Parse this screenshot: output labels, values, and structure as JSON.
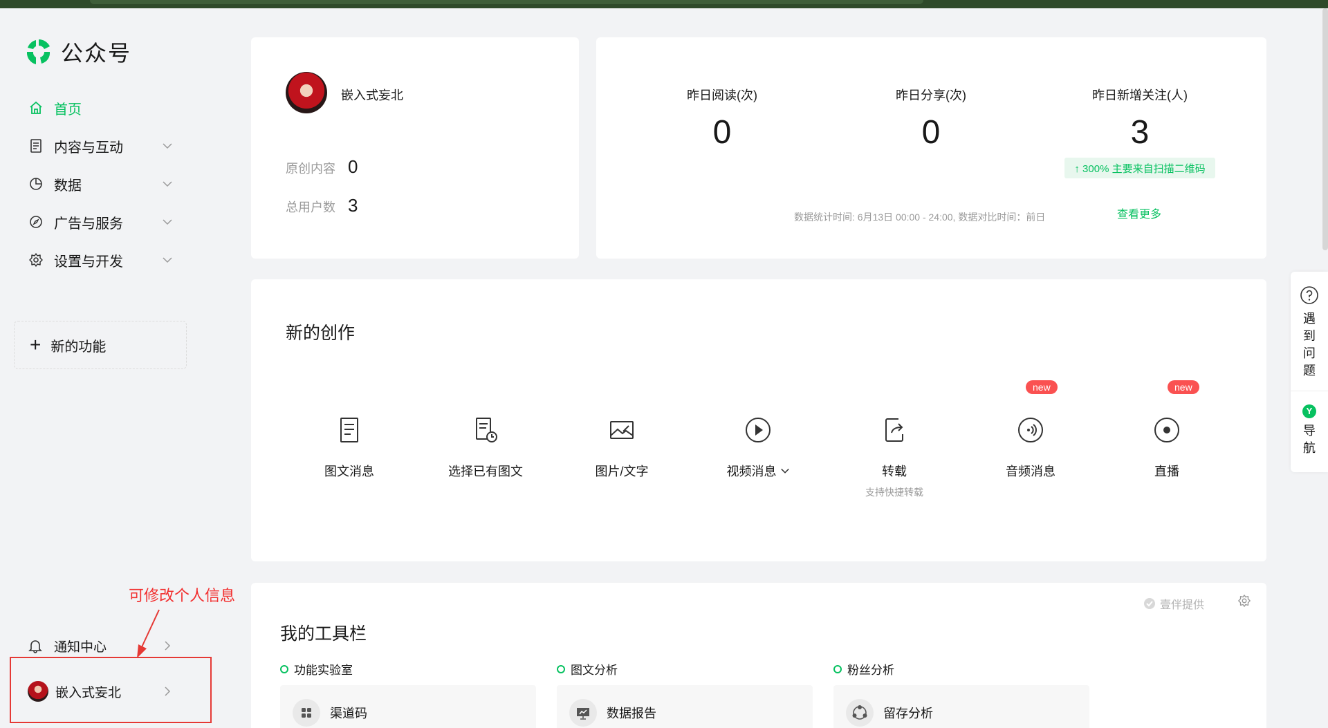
{
  "app": {
    "logo_text": "公众号",
    "brand_color": "#07c160"
  },
  "sidebar": {
    "items": [
      {
        "label": "首页",
        "icon": "home-icon",
        "active": true
      },
      {
        "label": "内容与互动",
        "icon": "document-icon"
      },
      {
        "label": "数据",
        "icon": "chart-pie-icon"
      },
      {
        "label": "广告与服务",
        "icon": "compass-icon"
      },
      {
        "label": "设置与开发",
        "icon": "gear-icon"
      }
    ],
    "new_feature": "新的功能",
    "annotation": "可修改个人信息",
    "notification": "通知中心",
    "account": "嵌入式妄北"
  },
  "profile": {
    "name": "嵌入式妄北",
    "original_label": "原创内容",
    "original_value": "0",
    "users_label": "总用户数",
    "users_value": "3"
  },
  "stats": {
    "items": [
      {
        "label": "昨日阅读(次)",
        "value": "0"
      },
      {
        "label": "昨日分享(次)",
        "value": "0"
      },
      {
        "label": "昨日新增关注(人)",
        "value": "3"
      }
    ],
    "growth": "↑ 300%   主要来自扫描二维码",
    "note": "数据统计时间: 6月13日 00:00 - 24:00, 数据对比时间：前日",
    "more": "查看更多"
  },
  "create": {
    "title": "新的创作",
    "badge": "new",
    "tools": [
      {
        "label": "图文消息",
        "icon": "article-icon"
      },
      {
        "label": "选择已有图文",
        "icon": "select-article-icon"
      },
      {
        "label": "图片/文字",
        "icon": "image-text-icon"
      },
      {
        "label": "视频消息",
        "icon": "video-play-icon"
      },
      {
        "label": "转载",
        "icon": "share-out-icon",
        "sub": "支持快捷转载"
      },
      {
        "label": "音频消息",
        "icon": "audio-icon"
      },
      {
        "label": "直播",
        "icon": "live-icon"
      }
    ]
  },
  "toolbar": {
    "title": "我的工具栏",
    "provider": "壹伴提供",
    "sections": [
      {
        "label": "功能实验室",
        "tile": "渠道码"
      },
      {
        "label": "图文分析",
        "tile": "数据报告"
      },
      {
        "label": "粉丝分析",
        "tile": "留存分析"
      }
    ]
  },
  "helper": {
    "problem": "遇到问题",
    "nav": "导航",
    "nav_icon_char": "Y"
  }
}
